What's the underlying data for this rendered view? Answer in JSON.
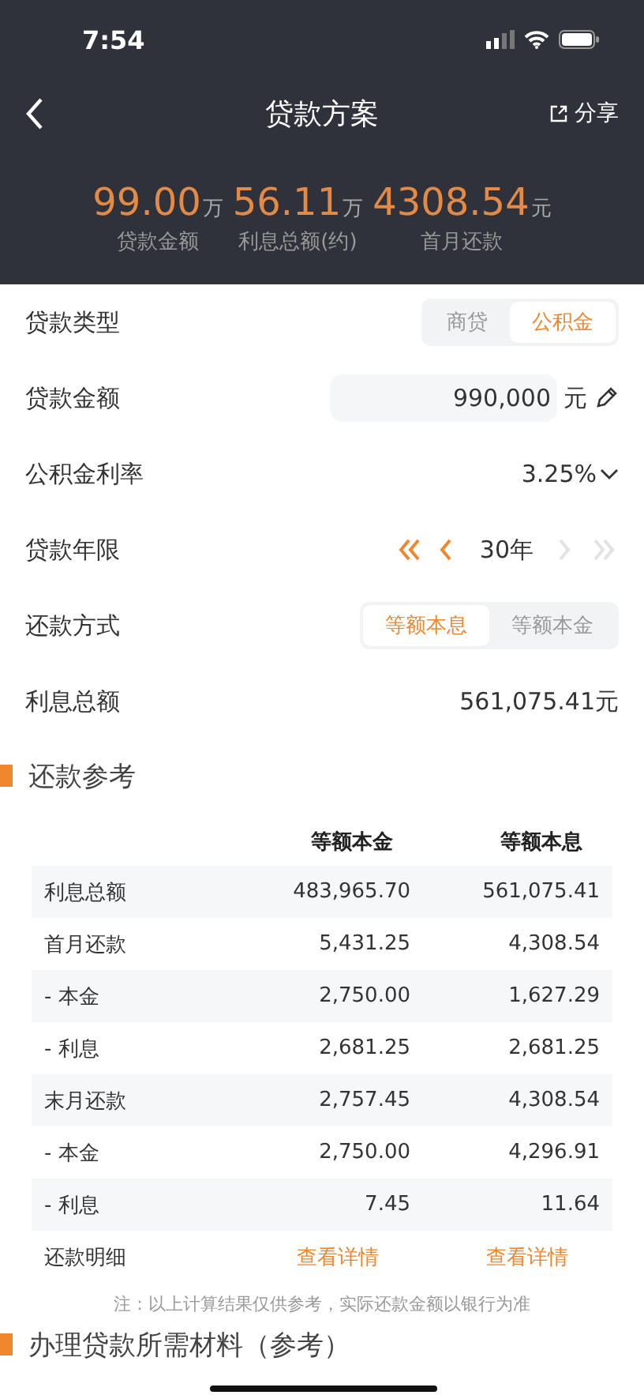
{
  "status_bar": {
    "time": "7:54"
  },
  "nav": {
    "title": "贷款方案",
    "share": "分享"
  },
  "summary": [
    {
      "value": "99.00",
      "unit": "万",
      "label": "贷款金额"
    },
    {
      "value": "56.11",
      "unit": "万",
      "label": "利息总额(约)"
    },
    {
      "value": "4308.54",
      "unit": "元",
      "label": "首月还款"
    }
  ],
  "form": [
    {
      "kind": "segmented",
      "label": "贷款类型",
      "options": [
        {
          "label": "商贷",
          "selected": false
        },
        {
          "label": "公积金",
          "selected": true
        }
      ]
    },
    {
      "kind": "field",
      "label": "贷款金额",
      "value": "990,000",
      "unit": "元"
    },
    {
      "kind": "dropdown",
      "label": "公积金利率",
      "value": "3.25%"
    },
    {
      "kind": "stepper",
      "label": "贷款年限",
      "value": "30年",
      "controls": [
        {
          "kind": "double-left",
          "disabled": false
        },
        {
          "kind": "left",
          "disabled": false
        },
        {
          "kind": "right",
          "disabled": true
        },
        {
          "kind": "double-right",
          "disabled": true
        }
      ]
    },
    {
      "kind": "segmented",
      "label": "还款方式",
      "options": [
        {
          "label": "等额本息",
          "selected": true
        },
        {
          "label": "等额本金",
          "selected": false
        }
      ]
    },
    {
      "kind": "text",
      "label": "利息总额",
      "value": "561,075.41元"
    }
  ],
  "reference": {
    "title": "还款参考",
    "columns": [
      "等额本金",
      "等额本息"
    ],
    "rows": [
      {
        "label": "利息总额",
        "values": [
          "483,965.70",
          "561,075.41"
        ]
      },
      {
        "label": "首月还款",
        "values": [
          "5,431.25",
          "4,308.54"
        ]
      },
      {
        "label": "- 本金",
        "values": [
          "2,750.00",
          "1,627.29"
        ]
      },
      {
        "label": "- 利息",
        "values": [
          "2,681.25",
          "2,681.25"
        ]
      },
      {
        "label": "末月还款",
        "values": [
          "2,757.45",
          "4,308.54"
        ]
      },
      {
        "label": "- 本金",
        "values": [
          "2,750.00",
          "4,296.91"
        ]
      },
      {
        "label": "- 利息",
        "values": [
          "7.45",
          "11.64"
        ]
      }
    ],
    "detail": {
      "label": "还款明细",
      "links": [
        "查看详情",
        "查看详情"
      ]
    },
    "note": "注：以上计算结果仅供参考，实际还款金额以银行为准"
  },
  "materials": {
    "title": "办理贷款所需材料（参考）"
  }
}
